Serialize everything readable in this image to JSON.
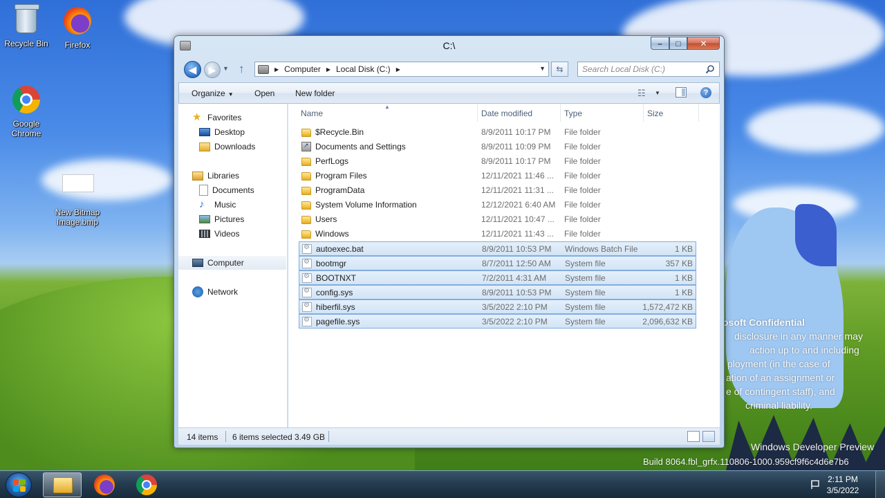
{
  "window": {
    "title": "C:\\",
    "caption": {
      "minimize": "–",
      "maximize": "□",
      "close": "✕"
    }
  },
  "address": {
    "crumbs": [
      "Computer",
      "Local Disk (C:)"
    ],
    "search_placeholder": "Search Local Disk (C:)"
  },
  "commands": {
    "organize": "Organize",
    "open": "Open",
    "new_folder": "New folder"
  },
  "nav_pane": {
    "favorites": "Favorites",
    "favorites_items": [
      "Desktop",
      "Downloads"
    ],
    "libraries": "Libraries",
    "libraries_items": [
      "Documents",
      "Music",
      "Pictures",
      "Videos"
    ],
    "computer": "Computer",
    "network": "Network"
  },
  "columns": {
    "name": "Name",
    "date": "Date modified",
    "type": "Type",
    "size": "Size"
  },
  "files": [
    {
      "name": "$Recycle.Bin",
      "date": "8/9/2011 10:17 PM",
      "type": "File folder",
      "size": "",
      "icon": "folder-icon",
      "selected": false
    },
    {
      "name": "Documents and Settings",
      "date": "8/9/2011 10:09 PM",
      "type": "File folder",
      "size": "",
      "icon": "shortcut-folder-icon",
      "selected": false
    },
    {
      "name": "PerfLogs",
      "date": "8/9/2011 10:17 PM",
      "type": "File folder",
      "size": "",
      "icon": "folder-icon",
      "selected": false
    },
    {
      "name": "Program Files",
      "date": "12/11/2021 11:46 ...",
      "type": "File folder",
      "size": "",
      "icon": "folder-icon",
      "selected": false
    },
    {
      "name": "ProgramData",
      "date": "12/11/2021 11:31 ...",
      "type": "File folder",
      "size": "",
      "icon": "folder-icon",
      "selected": false
    },
    {
      "name": "System Volume Information",
      "date": "12/12/2021 6:40 AM",
      "type": "File folder",
      "size": "",
      "icon": "folder-icon",
      "selected": false
    },
    {
      "name": "Users",
      "date": "12/11/2021 10:47 ...",
      "type": "File folder",
      "size": "",
      "icon": "folder-icon",
      "selected": false
    },
    {
      "name": "Windows",
      "date": "12/11/2021 11:43 ...",
      "type": "File folder",
      "size": "",
      "icon": "folder-icon",
      "selected": false
    },
    {
      "name": "autoexec.bat",
      "date": "8/9/2011 10:53 PM",
      "type": "Windows Batch File",
      "size": "1 KB",
      "icon": "system-file-icon",
      "selected": true
    },
    {
      "name": "bootmgr",
      "date": "8/7/2011 12:50 AM",
      "type": "System file",
      "size": "357 KB",
      "icon": "system-file-icon",
      "selected": true
    },
    {
      "name": "BOOTNXT",
      "date": "7/2/2011 4:31 AM",
      "type": "System file",
      "size": "1 KB",
      "icon": "system-file-icon",
      "selected": true
    },
    {
      "name": "config.sys",
      "date": "8/9/2011 10:53 PM",
      "type": "System file",
      "size": "1 KB",
      "icon": "system-file-icon",
      "selected": true
    },
    {
      "name": "hiberfil.sys",
      "date": "3/5/2022 2:10 PM",
      "type": "System file",
      "size": "1,572,472 KB",
      "icon": "system-file-icon",
      "selected": true
    },
    {
      "name": "pagefile.sys",
      "date": "3/5/2022 2:10 PM",
      "type": "System file",
      "size": "2,096,632 KB",
      "icon": "system-file-icon",
      "selected": true
    }
  ],
  "status": {
    "item_count": "14 items",
    "selected": "6 items selected",
    "selected_size": "3.49 GB"
  },
  "desktop_icons": {
    "recycle_bin": "Recycle Bin",
    "firefox": "Firefox",
    "chrome_line1": "Google",
    "chrome_line2": "Chrome",
    "bitmap_line1": "New Bitmap",
    "bitmap_line2": "Image.bmp"
  },
  "watermark": {
    "line1": "osoft Confidential",
    "line2": "disclosure in any manner may",
    "line3": "action up to and including",
    "line4": "ployment (in the case of",
    "line5": "ation of an assignment or",
    "line6": "e of contingent staff), and",
    "line7": "criminal liability.",
    "line8": "Windows Developer Preview",
    "line9": "Build 8064.fbl_grfx.110806-1000.959cf9f6c4d6e7b6"
  },
  "taskbar": {
    "time": "2:11 PM",
    "date": "3/5/2022"
  },
  "colors": {
    "accent": "#2f73c8",
    "selection": "#d2e4f6",
    "selection_border": "#84acdd"
  }
}
